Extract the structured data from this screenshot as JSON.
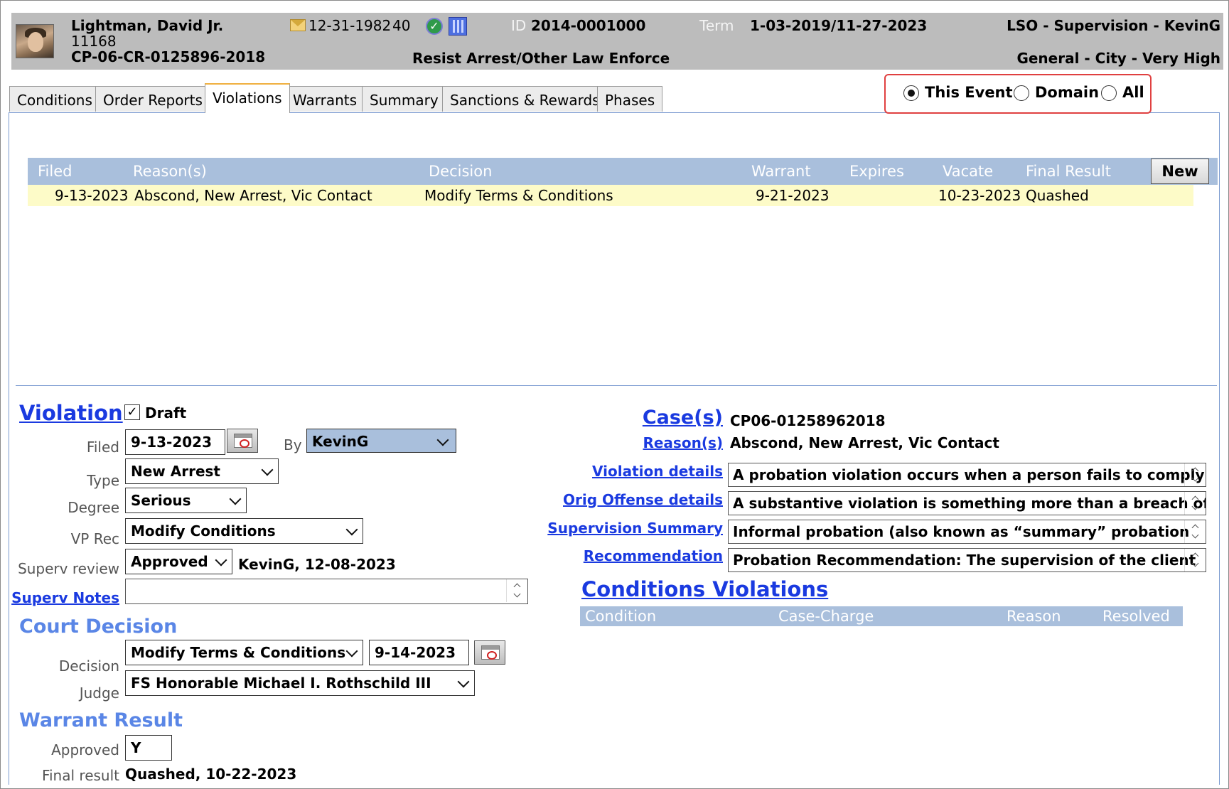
{
  "header": {
    "name": "Lightman, David Jr.",
    "number": "11168",
    "case_number": "CP-06-CR-0125896-2018",
    "dob": "12-31-1982",
    "age": "40",
    "id_label": "ID",
    "id_value": "2014-0001000",
    "term_label": "Term",
    "term_value": "1-03-2019/11-27-2023",
    "offense": "Resist Arrest/Other Law Enforce",
    "supervision": "LSO - Supervision - KevinG",
    "classification": "General - City - Very High",
    "icons": [
      "photo-avatar",
      "mail-icon",
      "check-circle-icon",
      "columns-icon"
    ]
  },
  "tabs": [
    {
      "label": "Conditions"
    },
    {
      "label": "Order Reports"
    },
    {
      "label": "Violations",
      "active": true
    },
    {
      "label": "Warrants"
    },
    {
      "label": "Summary"
    },
    {
      "label": "Sanctions & Rewards"
    },
    {
      "label": "Phases"
    }
  ],
  "scope": {
    "options": [
      "This Event",
      "Domain",
      "All"
    ],
    "selected": "This Event"
  },
  "violations_table": {
    "columns": [
      "Filed",
      "Reason(s)",
      "Decision",
      "Warrant",
      "Expires",
      "Vacate",
      "Final Result"
    ],
    "new_button": "New",
    "rows": [
      {
        "filed": "9-13-2023",
        "reasons": "Abscond, New Arrest, Vic Contact",
        "decision": "Modify Terms & Conditions",
        "warrant": "9-21-2023",
        "expires": "",
        "vacate": "10-23-2023",
        "final_result": "Quashed"
      }
    ]
  },
  "violation": {
    "title": "Violation",
    "draft_label": "Draft",
    "draft_checked": true,
    "filed_label": "Filed",
    "filed_value": "9-13-2023",
    "by_label": "By",
    "by_value": "KevinG",
    "type_label": "Type",
    "type_value": "New Arrest",
    "degree_label": "Degree",
    "degree_value": "Serious",
    "vp_rec_label": "VP Rec",
    "vp_rec_value": "Modify Conditions",
    "superv_review_label": "Superv review",
    "superv_review_value": "Approved",
    "superv_review_note": "KevinG, 12-08-2023",
    "superv_notes_label": "Superv Notes",
    "superv_notes_value": ""
  },
  "court_decision": {
    "title": "Court Decision",
    "decision_label": "Decision",
    "decision_value": "Modify Terms & Conditions",
    "decision_date": "9-14-2023",
    "judge_label": "Judge",
    "judge_value": "FS Honorable Michael I. Rothschild III"
  },
  "warrant_result": {
    "title": "Warrant Result",
    "approved_label": "Approved",
    "approved_value": "Y",
    "final_result_label": "Final result",
    "final_result_value": "Quashed, 10-22-2023"
  },
  "case_details": {
    "cases_label": "Case(s)",
    "cases_value": "CP06-01258962018",
    "reasons_label": "Reason(s)",
    "reasons_value": "Abscond, New Arrest, Vic Contact",
    "violation_details_label": "Violation details",
    "violation_details_value": "A probation violation occurs when a person fails to comply",
    "orig_offense_label": "Orig Offense details",
    "orig_offense_value": "A substantive violation is something more than a breach of",
    "supervision_summary_label": "Supervision Summary",
    "supervision_summary_value": "Informal probation (also known as “summary” probation",
    "recommendation_label": "Recommendation",
    "recommendation_value": "Probation Recommendation: The supervision of the client"
  },
  "conditions_violations": {
    "title": "Conditions Violations",
    "columns": [
      "Condition",
      "Case-Charge",
      "Reason",
      "Resolved"
    ]
  }
}
